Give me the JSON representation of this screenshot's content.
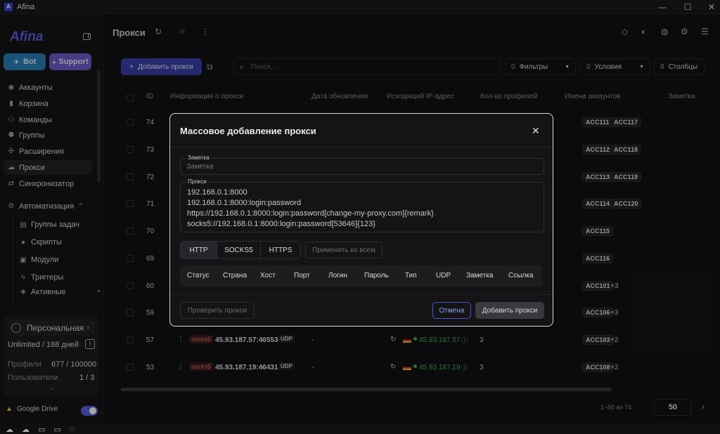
{
  "app": {
    "title": "Afina",
    "logo": "Afina"
  },
  "sidebar": {
    "bot_label": "Bot",
    "support_label": "Support",
    "nav": [
      {
        "label": "Аккаунты",
        "icon": "user-icon"
      },
      {
        "label": "Корзина",
        "icon": "trash-icon"
      },
      {
        "label": "Команды",
        "icon": "team-icon"
      },
      {
        "label": "Группы",
        "icon": "group-icon"
      },
      {
        "label": "Расширения",
        "icon": "puzzle-icon"
      },
      {
        "label": "Прокси",
        "icon": "cloud-icon"
      },
      {
        "label": "Синхронизатор",
        "icon": "sync-icon"
      }
    ],
    "automation_label": "Автоматизация",
    "automation_items": [
      {
        "label": "Группы задач",
        "icon": "tasks-icon"
      },
      {
        "label": "Скрипты",
        "icon": "github-icon"
      },
      {
        "label": "Модули",
        "icon": "module-icon"
      },
      {
        "label": "Триггеры",
        "icon": "bolt-icon"
      },
      {
        "label": "Активные задачи",
        "icon": "active-icon"
      }
    ],
    "plan": {
      "name": "Персональная",
      "subscription": "Unlimited / 188 дней",
      "profiles_label": "Профили",
      "profiles_value": "677 / 100000",
      "users_label": "Пользователи",
      "users_value": "1 / 3"
    },
    "gdrive_label": "Google Drive"
  },
  "main": {
    "title": "Прокси",
    "add_label": "Добавить прокси",
    "search_placeholder": "Поиск...",
    "filters_count": "0",
    "filters_label": "Фильтры",
    "conditions_count": "0",
    "conditions_label": "Условия",
    "columns_count": "8",
    "columns_label": "Столбцы",
    "headers": [
      "ID",
      "Информация о прокси",
      "Дата обновления",
      "Исходящий IP-адрес",
      "Кол-во профилей",
      "Имена аккаунтов",
      "Заметка"
    ],
    "rows": [
      {
        "id": "74",
        "accounts": [
          "ACC111",
          "ACC117"
        ],
        "more": ""
      },
      {
        "id": "73",
        "accounts": [
          "ACC112",
          "ACC118"
        ],
        "more": ""
      },
      {
        "id": "72",
        "accounts": [
          "ACC113",
          "ACC119"
        ],
        "more": ""
      },
      {
        "id": "71",
        "accounts": [
          "ACC114",
          "ACC120"
        ],
        "more": ""
      },
      {
        "id": "70",
        "accounts": [
          "ACC115"
        ],
        "more": ""
      },
      {
        "id": "69",
        "accounts": [
          "ACC116"
        ],
        "more": ""
      },
      {
        "id": "60",
        "accounts": [
          "ACC101"
        ],
        "more": "+3"
      },
      {
        "id": "59",
        "accounts": [
          "ACC106"
        ],
        "more": "+3"
      },
      {
        "id": "57",
        "proto": "socks5",
        "addr": "45.93.187.57:46553",
        "type": "UDP",
        "date": "-",
        "ip": "45.93.187.57",
        "profiles": "3",
        "accounts": [
          "ACC103"
        ],
        "more": "+2"
      },
      {
        "id": "53",
        "proto": "socks5",
        "addr": "45.93.187.19:46431",
        "type": "UDP",
        "date": "-",
        "ip": "45.93.187.19",
        "profiles": "3",
        "accounts": [
          "ACC108"
        ],
        "more": "+2"
      }
    ],
    "pagination": {
      "range": "1–50 из 74",
      "page_size": "50"
    }
  },
  "modal": {
    "title": "Массовое добавление прокси",
    "note_label": "Заметка",
    "note_placeholder": "Заметка",
    "proxies_label": "Прокси",
    "proxies_lines": [
      "192.168.0.1:8000",
      "192.168.0.1:8000:login:password",
      "https://192.168.0.1:8000:login:password[change-my-proxy.com]{remark}",
      "socks5://192.168.0.1:8000:login:password[53646]{123}"
    ],
    "tabs": [
      "HTTP",
      "SOCKS5",
      "HTTPS"
    ],
    "apply_all": "Применить ко всем",
    "columns": [
      "Статус",
      "Страна",
      "Хост",
      "Порт",
      "Логин",
      "Пароль",
      "Тип",
      "UDP",
      "Заметка",
      "Ссылка"
    ],
    "check_label": "Проверить прокси",
    "cancel_label": "Отмена",
    "submit_label": "Добавить прокси"
  },
  "colors": {
    "accent": "#5a5fe0",
    "bot": "#2a7fb8",
    "support": "#6b5cc9",
    "ip_ok": "#3fae5a"
  }
}
